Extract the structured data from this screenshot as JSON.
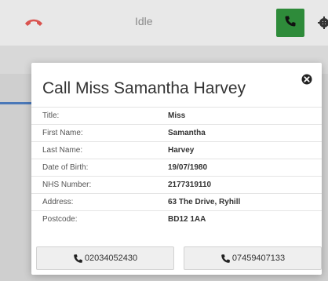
{
  "topbar": {
    "status": "Idle"
  },
  "modal": {
    "title": "Call Miss Samantha Harvey",
    "fields": [
      {
        "label": "Title:",
        "value": "Miss"
      },
      {
        "label": "First Name:",
        "value": "Samantha"
      },
      {
        "label": "Last Name:",
        "value": "Harvey"
      },
      {
        "label": "Date of Birth:",
        "value": "19/07/1980"
      },
      {
        "label": "NHS Number:",
        "value": "2177319110"
      },
      {
        "label": "Address:",
        "value": "63 The Drive, Ryhill"
      },
      {
        "label": "Postcode:",
        "value": "BD12 1AA"
      }
    ],
    "buttons": {
      "phone1": "02034052430",
      "phone2": "07459407133"
    }
  },
  "colors": {
    "hangup": "#d9534f",
    "answer": "#2e8b3a",
    "accent": "#4a78b8"
  },
  "icons": {
    "hangup": "phone-hangup-icon",
    "answer": "phone-icon",
    "settings": "gear-icon",
    "close": "close-circle-icon"
  }
}
